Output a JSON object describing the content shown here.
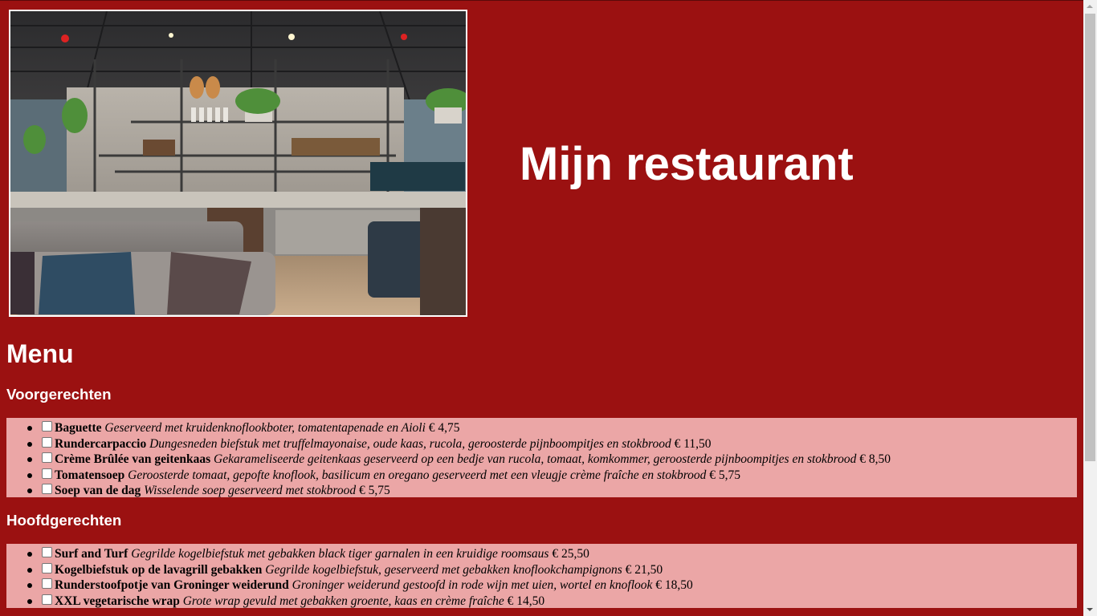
{
  "site_title": "Mijn restaurant",
  "menu_title": "Menu",
  "sections": [
    {
      "title": "Voorgerechten",
      "dishes": [
        {
          "name": "Baguette",
          "description": "Geserveerd met kruidenknoflookboter, tomatentapenade en Aioli",
          "price": "€ 4,75"
        },
        {
          "name": "Rundercarpaccio",
          "description": "Dungesneden biefstuk met truffelmayonaise, oude kaas, rucola, geroosterde pijnboompitjes en stokbrood",
          "price": "€ 11,50"
        },
        {
          "name": "Crème Brûlée van geitenkaas",
          "description": "Gekarameliseerde geitenkaas geserveerd op een bedje van rucola, tomaat, komkommer, geroosterde pijnboompitjes en stokbrood",
          "price": "€ 8,50"
        },
        {
          "name": "Tomatensoep",
          "description": "Geroosterde tomaat, gepofte knoflook, basilicum en oregano geserveerd met een vleugje crème fraîche en stokbrood",
          "price": "€ 5,75"
        },
        {
          "name": "Soep van de dag",
          "description": "Wisselende soep geserveerd met stokbrood",
          "price": "€ 5,75"
        }
      ]
    },
    {
      "title": "Hoofdgerechten",
      "dishes": [
        {
          "name": "Surf and Turf",
          "description": "Gegrilde kogelbiefstuk met gebakken black tiger garnalen in een kruidige roomsaus",
          "price": "€ 25,50"
        },
        {
          "name": "Kogelbiefstuk op de lavagrill gebakken",
          "description": "Gegrilde kogelbiefstuk, geserveerd met gebakken knoflookchampignons",
          "price": "€ 21,50"
        },
        {
          "name": "Runderstoofpotje van Groninger weiderund",
          "description": "Groninger weiderund gestoofd in rode wijn met uien, wortel en knoflook",
          "price": "€ 18,50"
        },
        {
          "name": "XXL vegetarische wrap",
          "description": "Grote wrap gevuld met gebakken groente, kaas en crème fraîche",
          "price": "€ 14,50"
        }
      ]
    }
  ],
  "colors": {
    "page_background": "#9b1111",
    "list_background": "#eba6a6",
    "heading_text": "#ffffff"
  },
  "icons": {
    "list_marker": "filled-circle-bullet",
    "dish_toggle": "checkbox-unchecked"
  }
}
